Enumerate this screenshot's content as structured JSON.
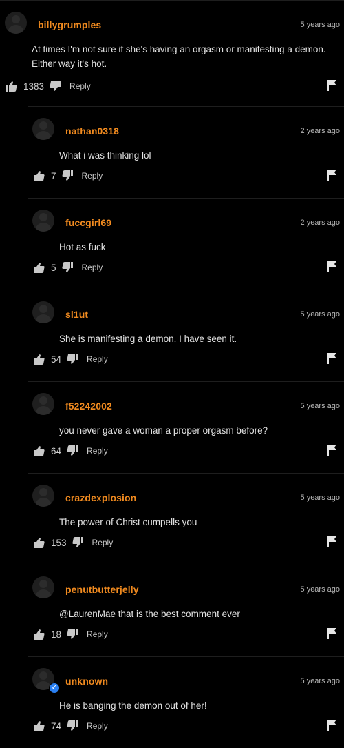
{
  "comments": [
    {
      "username": "billygrumples",
      "time": "5 years ago",
      "text": "At times I'm not sure if she's having an orgasm or manifesting a demon. Either way it's hot.",
      "votes": "1383",
      "reply_label": "Reply"
    },
    {
      "username": "nathan0318",
      "time": "2 years ago",
      "text": "What i was thinking lol",
      "votes": "7",
      "reply_label": "Reply"
    },
    {
      "username": "fuccgirl69",
      "time": "2 years ago",
      "text": "Hot as fuck",
      "votes": "5",
      "reply_label": "Reply"
    },
    {
      "username": "sl1ut",
      "time": "5 years ago",
      "text": "She is manifesting a demon. I have seen it.",
      "votes": "54",
      "reply_label": "Reply"
    },
    {
      "username": "f52242002",
      "time": "5 years ago",
      "text": "you never gave a woman a proper orgasm before?",
      "votes": "64",
      "reply_label": "Reply"
    },
    {
      "username": "crazdexplosion",
      "time": "5 years ago",
      "text": "The power of Christ cumpells you",
      "votes": "153",
      "reply_label": "Reply"
    },
    {
      "username": "penutbutterjelly",
      "time": "5 years ago",
      "text": "@LaurenMae that is the best comment ever",
      "votes": "18",
      "reply_label": "Reply"
    },
    {
      "username": "unknown",
      "time": "5 years ago",
      "text": "He is banging the demon out of her!",
      "votes": "74",
      "reply_label": "Reply",
      "verified_badge": "check-icon"
    }
  ],
  "colors": {
    "background": "#000000",
    "username": "#f08a1f",
    "text": "#e2e2e2",
    "muted": "#b5b5b5",
    "verified": "#2a7ff0"
  },
  "icons": {
    "upvote": "thumb-up-icon",
    "downvote": "thumb-down-icon",
    "report": "flag-icon",
    "avatar": "default-avatar-icon"
  }
}
